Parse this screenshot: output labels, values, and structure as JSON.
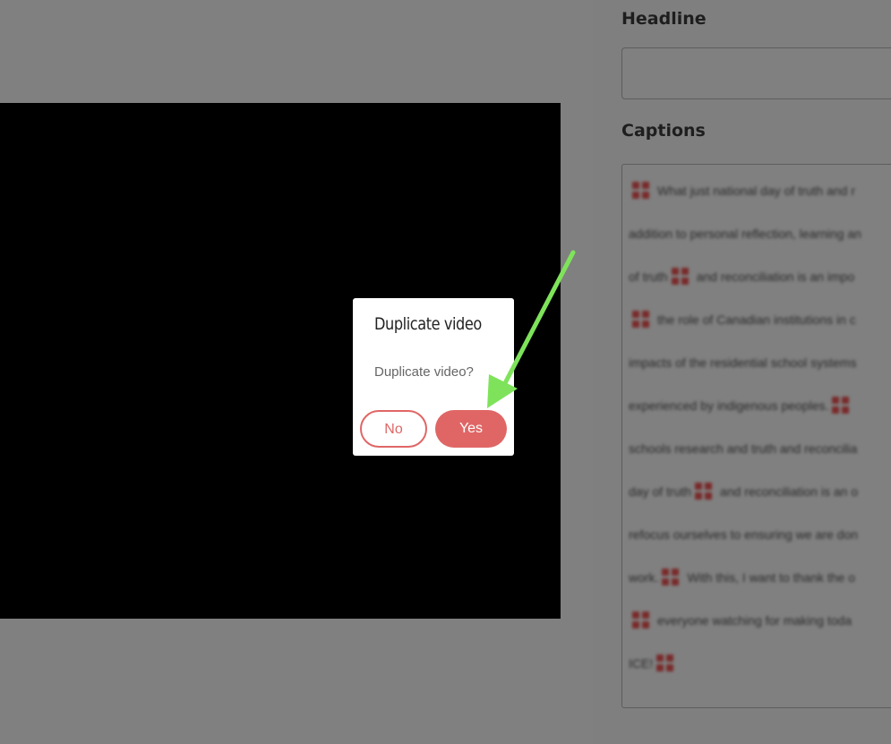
{
  "panel": {
    "headline_label": "Headline",
    "headline_value": "",
    "captions_label": "Captions",
    "captions_lines": [
      "What just national day of truth and r",
      "addition to personal reflection, learning an",
      "of truth",
      "and reconciliation is an impo",
      "the role of Canadian institutions in c",
      "impacts of the residential school systems",
      "experienced by indigenous peoples.",
      "schools research and truth and reconcilia",
      "day of truth",
      "and reconciliation is an o",
      "refocus ourselves to ensuring we are don",
      "work.",
      "With this, I want to thank the o",
      "everyone watching for making toda",
      "ICE!"
    ]
  },
  "dialog": {
    "title": "Duplicate video",
    "message": "Duplicate video?",
    "no_label": "No",
    "yes_label": "Yes"
  },
  "colors": {
    "accent": "#e06666",
    "arrow": "#7ee35a",
    "drag_icon": "#7a2a2a"
  },
  "icons": {
    "caption_marker": "drag-handle-icon"
  }
}
